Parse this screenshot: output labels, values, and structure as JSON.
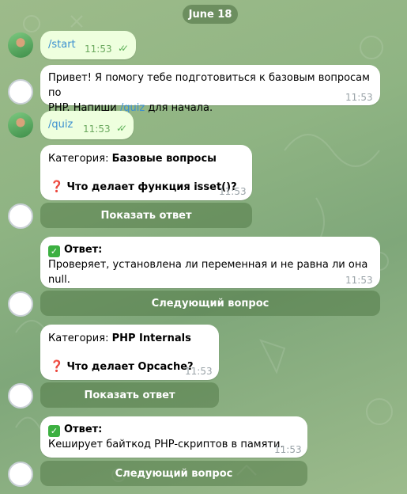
{
  "date": "June 18",
  "messages": {
    "m1": {
      "text": "/start",
      "time": "11:53"
    },
    "m2": {
      "text_before": "Привет! Я помогу тебе подготовиться к базовым вопросам по",
      "text_line2": "PHP. Напиши ",
      "command": "/quiz",
      "text_after": " для начала.",
      "time": "11:53"
    },
    "m3": {
      "text": "/quiz",
      "time": "11:53"
    },
    "m4": {
      "category_label": "Категория:",
      "category": "Базовые вопросы",
      "question": "Что делает функция isset()?",
      "time": "11:53",
      "button": "Показать ответ"
    },
    "m5": {
      "answer_label": "Ответ:",
      "answer": "Проверяет, установлена ли переменная и не равна ли она null.",
      "time": "11:53",
      "button": "Следующий вопрос"
    },
    "m6": {
      "category_label": "Категория:",
      "category": "PHP Internals",
      "question": "Что делает Opcache?",
      "time": "11:53",
      "button": "Показать ответ"
    },
    "m7": {
      "answer_label": "Ответ:",
      "answer": "Кеширует байткод PHP-скриптов в памяти.",
      "time": "11:53",
      "button": "Следующий вопрос"
    }
  },
  "icons": {
    "user_avatar": "user-avatar",
    "bot_avatar": "bot-avatar",
    "read": "double-check-icon",
    "question": "question-mark-icon",
    "check": "checkbox-icon"
  },
  "colors": {
    "outgoing_bubble": "#eeffde",
    "incoming_bubble": "#ffffff",
    "link": "#3a8fd0",
    "keyboard_button": "#6a8f5f"
  }
}
